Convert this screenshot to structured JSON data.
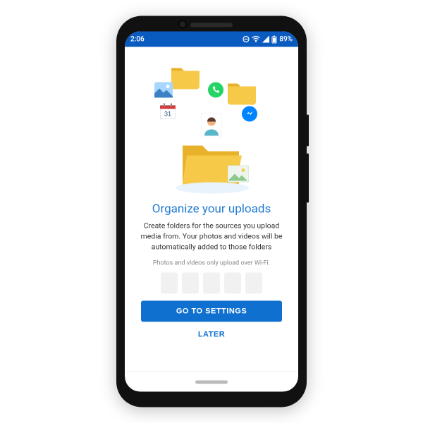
{
  "status": {
    "time": "2:06",
    "battery": "89%"
  },
  "headline": "Organize your uploads",
  "body": "Create folders for the sources you upload media from. Your photos and videos will be automatically added to those folders",
  "note": "Photos and videos only upload over Wi-Fi.",
  "primary_label": "GO TO SETTINGS",
  "secondary_label": "LATER",
  "colors": {
    "primary": "#1070d0",
    "statusbar": "#0a5bbf",
    "folder": "#f7c948",
    "folder_dark": "#e8b12c"
  }
}
